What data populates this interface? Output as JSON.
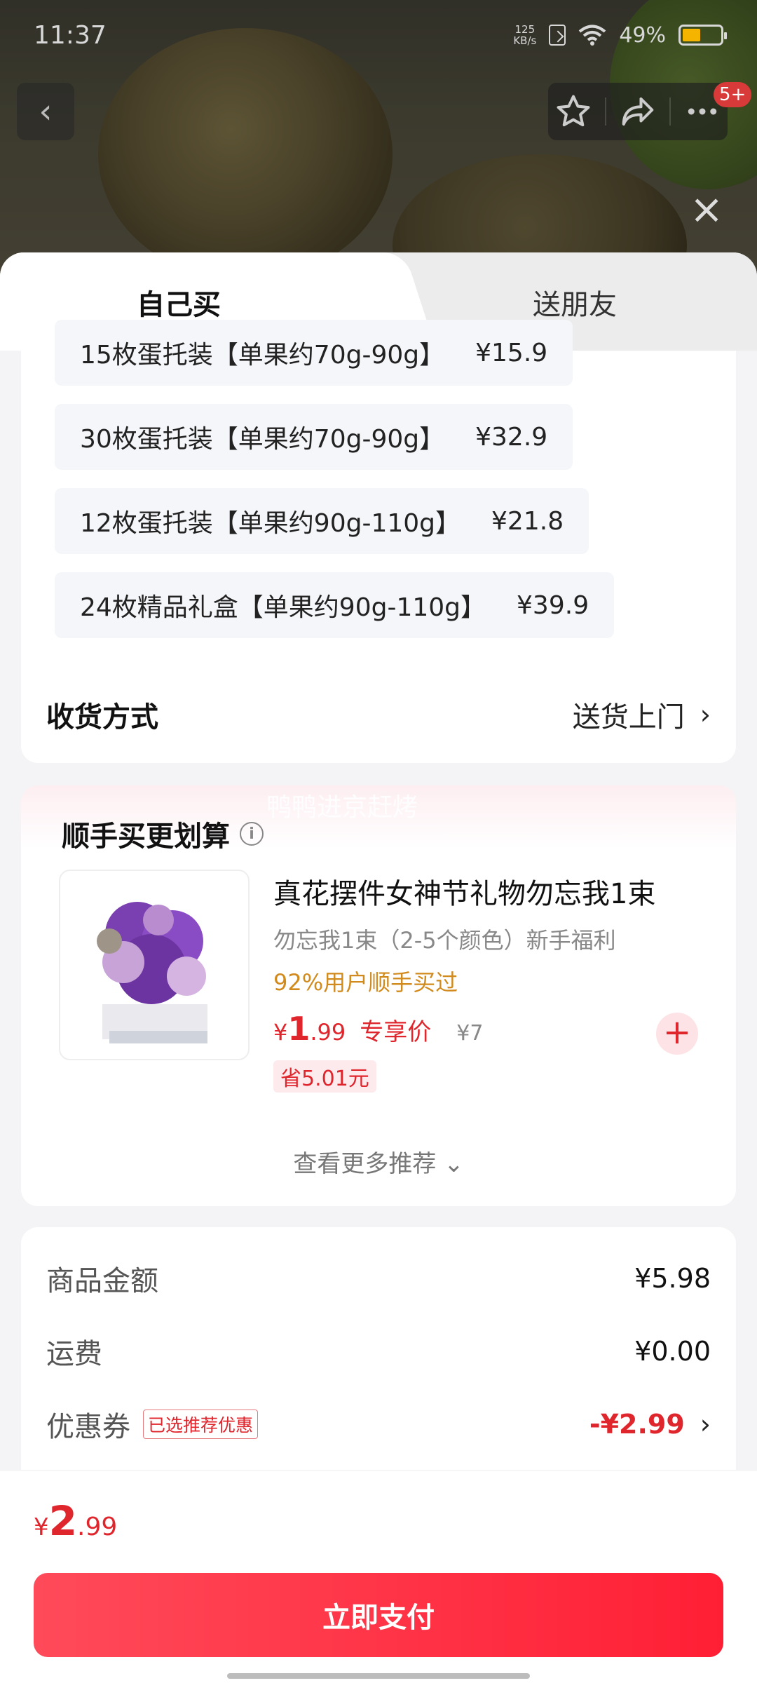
{
  "status_bar": {
    "time": "11:37",
    "net_speed": "125",
    "net_unit": "KB/s",
    "battery": "49%",
    "battery_level": 0.49
  },
  "top_actions": {
    "badge": "5+"
  },
  "tabs": {
    "self": "自己买",
    "gift": "送朋友"
  },
  "skus": [
    {
      "label": "15枚蛋托装【单果约70g-90g】",
      "price": "¥15.9"
    },
    {
      "label": "30枚蛋托装【单果约70g-90g】",
      "price": "¥32.9"
    },
    {
      "label": "12枚蛋托装【单果约90g-110g】",
      "price": "¥21.8"
    },
    {
      "label": "24枚精品礼盒【单果约90g-110g】",
      "price": "¥39.9"
    }
  ],
  "delivery": {
    "label": "收货方式",
    "value": "送货上门"
  },
  "upsell": {
    "watermark": "鸭鸭进京赶烤",
    "title": "顺手买更划算",
    "product": {
      "title": "真花摆件女神节礼物勿忘我1束",
      "subtitle": "勿忘我1束（2-5个颜色）新手福利",
      "bought": "92%用户顺手买过",
      "price_symbol": "¥",
      "price_int": "1",
      "price_dec": ".99",
      "exclusive": "专享价",
      "original_price": "¥7",
      "save": "省5.01元"
    },
    "more": "查看更多推荐"
  },
  "summary": {
    "goods_label": "商品金额",
    "goods_value": "¥5.98",
    "shipping_label": "运费",
    "shipping_value": "¥0.00",
    "coupon_label": "优惠券",
    "coupon_tag": "已选推荐优惠",
    "coupon_value": "-¥2.99"
  },
  "footer": {
    "symbol": "¥",
    "int": "2",
    "dec": ".99",
    "pay": "立即支付"
  },
  "colors": {
    "accent": "#e0262d",
    "pay_button": "#ff2a3f",
    "battery": "#f4b400"
  }
}
